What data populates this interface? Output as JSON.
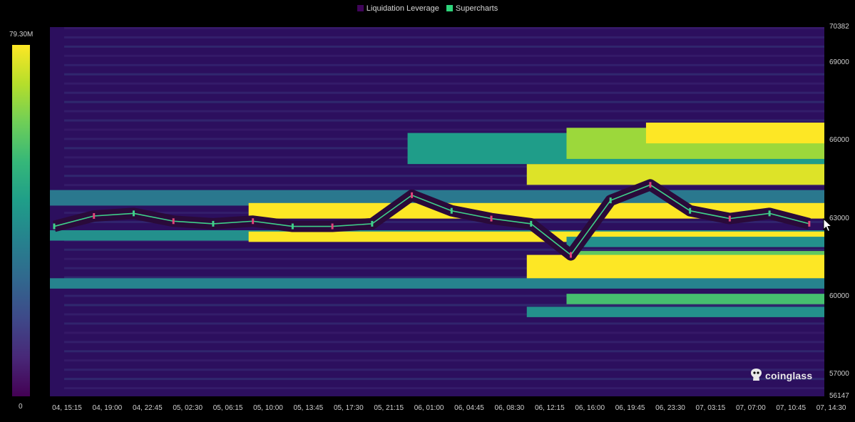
{
  "legend": {
    "items": [
      {
        "label": "Liquidation Leverage",
        "color": "#40045a"
      },
      {
        "label": "Supercharts",
        "color": "#2ed47a"
      }
    ]
  },
  "colorbar": {
    "max_label": "79.30M",
    "min_label": "0",
    "colors": [
      "#fde725",
      "#b5de2b",
      "#6ece58",
      "#35b779",
      "#1f9e89",
      "#26828e",
      "#31688e",
      "#3e4989",
      "#482878",
      "#440154"
    ]
  },
  "watermark": {
    "text": "coinglass"
  },
  "chart_data": {
    "type": "heatmap",
    "title": "",
    "xlabel": "",
    "ylabel": "",
    "x_ticks": [
      "04, 15:15",
      "04, 19:00",
      "04, 22:45",
      "05, 02:30",
      "05, 06:15",
      "05, 10:00",
      "05, 13:45",
      "05, 17:30",
      "05, 21:15",
      "06, 01:00",
      "06, 04:45",
      "06, 08:30",
      "06, 12:15",
      "06, 16:00",
      "06, 19:45",
      "06, 23:30",
      "07, 03:15",
      "07, 07:00",
      "07, 10:45",
      "07, 14:30"
    ],
    "y_ticks": [
      70382,
      69000,
      66000,
      63000,
      60000,
      57000,
      56147
    ],
    "ylim": [
      56147,
      70382
    ],
    "value_range": [
      "0",
      "79.30M"
    ],
    "price_series": {
      "name": "Supercharts",
      "times": [
        "04, 15:15",
        "04, 19:00",
        "04, 22:45",
        "05, 02:30",
        "05, 06:15",
        "05, 10:00",
        "05, 13:45",
        "05, 17:30",
        "05, 21:15",
        "06, 01:00",
        "06, 04:45",
        "06, 08:30",
        "06, 12:15",
        "06, 16:00",
        "06, 19:45",
        "06, 23:30",
        "07, 03:15",
        "07, 07:00",
        "07, 10:45",
        "07, 14:30"
      ],
      "values": [
        62700,
        63100,
        63200,
        62900,
        62800,
        62900,
        62700,
        62700,
        62800,
        63900,
        63300,
        63000,
        62800,
        61600,
        63700,
        64300,
        63300,
        63000,
        63200,
        62800
      ]
    },
    "liquidation_bands": [
      {
        "from": 65100,
        "to": 66300,
        "start": "06, 01:00",
        "intensity": 0.55
      },
      {
        "from": 65300,
        "to": 66500,
        "start": "06, 16:00",
        "intensity": 0.85
      },
      {
        "from": 64300,
        "to": 65100,
        "start": "06, 12:15",
        "intensity": 0.95
      },
      {
        "from": 65900,
        "to": 66700,
        "start": "06, 23:30",
        "intensity": 1.0
      },
      {
        "from": 63500,
        "to": 64100,
        "start": "04, 15:15",
        "intensity": 0.4
      },
      {
        "from": 63000,
        "to": 63600,
        "start": "05, 10:00",
        "intensity": 1.0
      },
      {
        "from": 62150,
        "to": 62550,
        "start": "04, 15:15",
        "intensity": 0.5
      },
      {
        "from": 62100,
        "to": 62500,
        "start": "05, 10:00",
        "intensity": 1.0
      },
      {
        "from": 61900,
        "to": 62300,
        "start": "06, 16:00",
        "intensity": 0.5
      },
      {
        "from": 61200,
        "to": 61750,
        "start": "06, 16:00",
        "intensity": 0.75
      },
      {
        "from": 60500,
        "to": 61600,
        "start": "06, 12:15",
        "intensity": 1.0
      },
      {
        "from": 60300,
        "to": 60700,
        "start": "04, 15:15",
        "intensity": 0.45
      },
      {
        "from": 59700,
        "to": 60100,
        "start": "06, 16:00",
        "intensity": 0.7
      },
      {
        "from": 59200,
        "to": 59600,
        "start": "06, 12:15",
        "intensity": 0.5
      }
    ]
  }
}
